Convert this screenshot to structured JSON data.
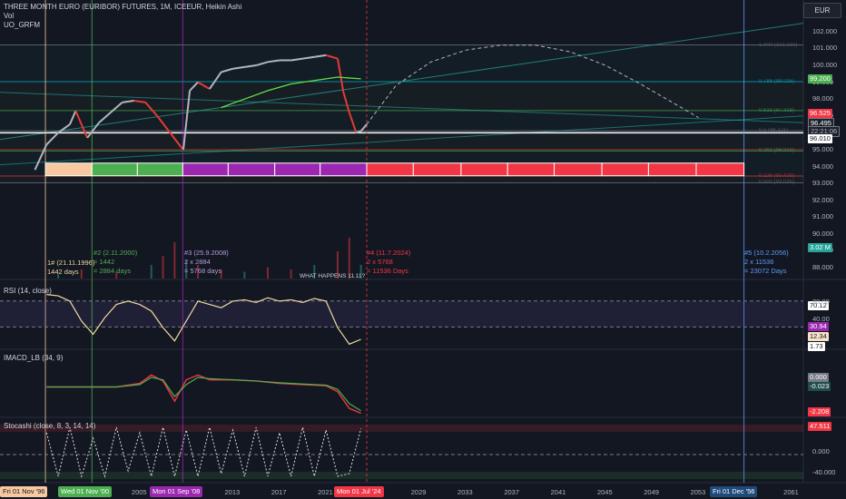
{
  "header": {
    "title": "THREE MONTH EURO (EURIBOR) FUTURES, 1M, ICEEUR, Heikin Ashi",
    "line2": "Vol",
    "line3": "UO_GRFM"
  },
  "currency_button": "EUR",
  "colors": {
    "background": "#131722",
    "price_up": "#b2b5be",
    "price_down": "#e53935",
    "green": "#4caf50",
    "purple": "#9c27b0",
    "red": "#f23645",
    "orange": "#f8c9a0",
    "blue": "#2962ff",
    "teal": "#26a69a"
  },
  "panes": {
    "rsi_label": "RSI (14, close)",
    "macd_label": "IMACD_LB (34, 9)",
    "stoch_label": "Stocashi (close, 8, 3, 14, 14)"
  },
  "annotations": {
    "cycle1": {
      "line1": "1# (21.11.1996)",
      "line2": "1442 days"
    },
    "cycle2": {
      "line0": "#2 (2.11.2000)",
      "line1": "= 1442",
      "line2": "= 2884 days"
    },
    "cycle3": {
      "line0": "#3 (25.9.2008)",
      "line1": "2 x 2884",
      "line2": "= 5768 days"
    },
    "cycle4": {
      "line0": "#4 (11.7.2024)",
      "line1": "2 x 5768",
      "line2": "= 11536 Days"
    },
    "cycle5": {
      "line0": "#5 (10.2.2056)",
      "line1": "2 x 11536",
      "line2": "= 23072 Days"
    },
    "what_happens": "WHAT HAPPENS 11.11?"
  },
  "price_tags": {
    "green_tag": "99.200",
    "red_tag": "96.525",
    "last": "96.495",
    "countdown": "22:21:06",
    "white_tag": "96.010",
    "volume": "3.02 M",
    "rsi_a": "70.12",
    "rsi_b": "30.94",
    "rsi_c": "12.34",
    "rsi_d": "1.73",
    "macd_a": "0.000",
    "macd_b": "-0.023",
    "macd_c": "-2.208",
    "stoch_a": "47.511"
  },
  "fib_labels": [
    "1.000 (101.210)",
    "0.786 (99.035)",
    "0.618 (97.318)",
    "0.5 (96.121)",
    "0.382 (94.920)",
    "0.236 (93.438)",
    "0.000 (93.035)"
  ],
  "chart_data": {
    "type": "line",
    "title": "THREE MONTH EURO (EURIBOR) FUTURES, 1M, ICEEUR, Heikin Ashi",
    "x_ticks": [
      "2005",
      "2013",
      "2017",
      "2021",
      "2029",
      "2033",
      "2037",
      "2041",
      "2045",
      "2049",
      "2053",
      "2061"
    ],
    "x_badges": [
      "Fri 01 Nov '96",
      "Wed 01 Nov '00",
      "Mon 01 Sep '08",
      "Mon 01 Jul '24",
      "Fri 01 Dec '56"
    ],
    "y_ticks": [
      102.0,
      101.0,
      100.0,
      99.0,
      98.0,
      97.0,
      96.0,
      95.0,
      94.0,
      93.0,
      92.0,
      91.0,
      90.0,
      89.0,
      88.0
    ],
    "y_tick_labels": [
      "102.000",
      "101.000",
      "100.000",
      "99.000",
      "98.000",
      "97.000",
      "96.000",
      "95.000",
      "94.000",
      "93.000",
      "92.000",
      "91.000",
      "90.000",
      "89.000",
      "88.000"
    ],
    "ylim": [
      87.3,
      102.8
    ],
    "xlim": [
      1993.0,
      2062.0
    ],
    "price_series": [
      [
        1996.0,
        93.8
      ],
      [
        1997.0,
        95.3
      ],
      [
        1998.0,
        96.0
      ],
      [
        1999.0,
        96.5
      ],
      [
        1999.5,
        97.3
      ],
      [
        2000.5,
        95.7
      ],
      [
        2001.5,
        96.6
      ],
      [
        2002.5,
        97.2
      ],
      [
        2003.5,
        97.8
      ],
      [
        2004.5,
        97.9
      ],
      [
        2005.5,
        97.8
      ],
      [
        2006.5,
        97.0
      ],
      [
        2007.5,
        96.1
      ],
      [
        2008.5,
        95.2
      ],
      [
        2008.75,
        95.0
      ],
      [
        2009.3,
        98.5
      ],
      [
        2010.0,
        99.0
      ],
      [
        2011.0,
        98.6
      ],
      [
        2012.0,
        99.6
      ],
      [
        2013.0,
        99.8
      ],
      [
        2014.0,
        99.9
      ],
      [
        2015.0,
        100.0
      ],
      [
        2016.0,
        100.2
      ],
      [
        2017.0,
        100.3
      ],
      [
        2018.0,
        100.3
      ],
      [
        2019.0,
        100.4
      ],
      [
        2020.0,
        100.5
      ],
      [
        2021.0,
        100.6
      ],
      [
        2022.0,
        100.4
      ],
      [
        2022.5,
        98.4
      ],
      [
        2023.0,
        97.2
      ],
      [
        2023.6,
        96.0
      ],
      [
        2024.0,
        96.1
      ],
      [
        2024.5,
        96.5
      ]
    ],
    "moving_average": [
      [
        2012.0,
        97.5
      ],
      [
        2014.0,
        98.0
      ],
      [
        2016.0,
        98.5
      ],
      [
        2018.0,
        98.9
      ],
      [
        2020.0,
        99.1
      ],
      [
        2022.0,
        99.3
      ],
      [
        2024.0,
        99.2
      ]
    ],
    "projection_arc": [
      [
        2024.5,
        96.5
      ],
      [
        2027.0,
        98.8
      ],
      [
        2030.0,
        100.2
      ],
      [
        2033.0,
        100.9
      ],
      [
        2036.0,
        101.2
      ],
      [
        2039.0,
        101.2
      ],
      [
        2042.0,
        100.8
      ],
      [
        2045.0,
        100.0
      ],
      [
        2048.0,
        98.9
      ],
      [
        2051.0,
        97.7
      ],
      [
        2053.0,
        96.9
      ]
    ],
    "fib_levels": [
      101.21,
      99.035,
      97.318,
      96.121,
      94.92,
      93.438,
      93.035
    ],
    "cycle_dates": [
      1996.9,
      2000.9,
      2008.7,
      2024.5,
      2056.9
    ],
    "cycle_blocks": [
      {
        "from": 1996.9,
        "to": 2000.9,
        "color": "orange"
      },
      {
        "from": 2000.9,
        "to": 2004.8,
        "color": "green"
      },
      {
        "from": 2004.8,
        "to": 2008.7,
        "color": "green"
      },
      {
        "from": 2008.7,
        "to": 2012.6,
        "color": "purple"
      },
      {
        "from": 2012.6,
        "to": 2016.6,
        "color": "purple"
      },
      {
        "from": 2016.6,
        "to": 2020.5,
        "color": "purple"
      },
      {
        "from": 2020.5,
        "to": 2024.5,
        "color": "purple"
      },
      {
        "from": 2024.5,
        "to": 2028.5,
        "color": "red"
      },
      {
        "from": 2028.5,
        "to": 2032.6,
        "color": "red"
      },
      {
        "from": 2032.6,
        "to": 2036.6,
        "color": "red"
      },
      {
        "from": 2036.6,
        "to": 2040.6,
        "color": "red"
      },
      {
        "from": 2040.6,
        "to": 2044.7,
        "color": "red"
      },
      {
        "from": 2044.7,
        "to": 2048.7,
        "color": "red"
      },
      {
        "from": 2048.7,
        "to": 2052.8,
        "color": "red"
      },
      {
        "from": 2052.8,
        "to": 2056.9,
        "color": "red"
      }
    ],
    "volume": [
      [
        1998,
        1
      ],
      [
        2000,
        2
      ],
      [
        2003,
        1.5
      ],
      [
        2006,
        3
      ],
      [
        2007,
        5
      ],
      [
        2008,
        8
      ],
      [
        2009,
        4
      ],
      [
        2010,
        3
      ],
      [
        2012,
        2
      ],
      [
        2014,
        1.5
      ],
      [
        2016,
        2.5
      ],
      [
        2018,
        2
      ],
      [
        2020,
        3
      ],
      [
        2022,
        6
      ],
      [
        2023,
        9
      ],
      [
        2024,
        3.02
      ]
    ],
    "rsi": {
      "ylim": [
        0,
        100
      ],
      "upper": 70.12,
      "lower": 30.94,
      "values": [
        [
          1997,
          80
        ],
        [
          1998,
          78
        ],
        [
          1999,
          70
        ],
        [
          2000,
          40
        ],
        [
          2001,
          20
        ],
        [
          2002,
          45
        ],
        [
          2003,
          65
        ],
        [
          2004,
          70
        ],
        [
          2005,
          65
        ],
        [
          2006,
          55
        ],
        [
          2007,
          30
        ],
        [
          2008,
          10
        ],
        [
          2009,
          40
        ],
        [
          2010,
          70
        ],
        [
          2011,
          65
        ],
        [
          2012,
          60
        ],
        [
          2013,
          70
        ],
        [
          2014,
          72
        ],
        [
          2015,
          68
        ],
        [
          2016,
          75
        ],
        [
          2017,
          70
        ],
        [
          2018,
          72
        ],
        [
          2019,
          68
        ],
        [
          2020,
          74
        ],
        [
          2021,
          70
        ],
        [
          2022,
          30
        ],
        [
          2023,
          5
        ],
        [
          2024,
          12.34
        ]
      ]
    },
    "macd": {
      "values": [
        [
          1997,
          0
        ],
        [
          2000,
          0
        ],
        [
          2003,
          0
        ],
        [
          2005,
          0.3
        ],
        [
          2006,
          1.0
        ],
        [
          2007,
          0.5
        ],
        [
          2008,
          -1.2
        ],
        [
          2009,
          0.6
        ],
        [
          2010,
          1.0
        ],
        [
          2011,
          0.6
        ],
        [
          2013,
          0.6
        ],
        [
          2015,
          0.5
        ],
        [
          2017,
          0.3
        ],
        [
          2019,
          0.2
        ],
        [
          2021,
          0.1
        ],
        [
          2022,
          -0.4
        ],
        [
          2023,
          -1.8
        ],
        [
          2024,
          -2.208
        ]
      ],
      "signal": [
        [
          1997,
          0
        ],
        [
          2000,
          0
        ],
        [
          2003,
          0
        ],
        [
          2005,
          0.2
        ],
        [
          2006,
          0.8
        ],
        [
          2007,
          0.6
        ],
        [
          2008,
          -0.8
        ],
        [
          2009,
          0.2
        ],
        [
          2010,
          0.8
        ],
        [
          2011,
          0.7
        ],
        [
          2013,
          0.6
        ],
        [
          2015,
          0.5
        ],
        [
          2017,
          0.35
        ],
        [
          2019,
          0.25
        ],
        [
          2021,
          0.15
        ],
        [
          2022,
          -0.2
        ],
        [
          2023,
          -1.4
        ],
        [
          2024,
          -2.0
        ]
      ]
    },
    "stoch": {
      "y_ticks": [
        "0.000",
        "-40.000"
      ],
      "values": [
        [
          1997,
          40
        ],
        [
          1998,
          -40
        ],
        [
          1999,
          50
        ],
        [
          2000,
          -40
        ],
        [
          2001,
          30
        ],
        [
          2002,
          -40
        ],
        [
          2003,
          50
        ],
        [
          2004,
          -30
        ],
        [
          2005,
          40
        ],
        [
          2006,
          -40
        ],
        [
          2007,
          50
        ],
        [
          2008,
          -40
        ],
        [
          2009,
          45
        ],
        [
          2010,
          -40
        ],
        [
          2011,
          50
        ],
        [
          2012,
          -35
        ],
        [
          2013,
          45
        ],
        [
          2014,
          -40
        ],
        [
          2015,
          50
        ],
        [
          2016,
          -40
        ],
        [
          2017,
          40
        ],
        [
          2018,
          -40
        ],
        [
          2019,
          50
        ],
        [
          2020,
          -40
        ],
        [
          2021,
          45
        ],
        [
          2022,
          -40
        ],
        [
          2023,
          -35
        ],
        [
          2024,
          47.511
        ]
      ]
    }
  }
}
